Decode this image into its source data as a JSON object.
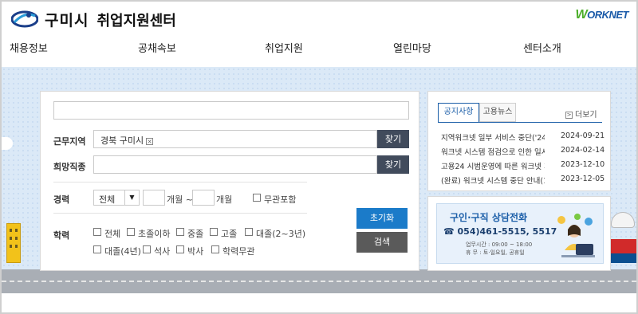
{
  "header": {
    "site_name": "구미시",
    "site_sub": "취업지원센터",
    "partner_logo_prefix": "W",
    "partner_logo": "ORKNET"
  },
  "nav": [
    "채용정보",
    "공채속보",
    "취업지원",
    "열린마당",
    "센터소개"
  ],
  "search": {
    "keyword_value": "",
    "region_label": "근무지역",
    "region_value": "경북 구미시",
    "region_remove_icon": "close-icon",
    "job_label": "희망직종",
    "job_value": "",
    "find_label": "찾기",
    "career_label": "경력",
    "career_select": "전체",
    "months_from_suffix": "개월 ~",
    "months_to_suffix": "개월",
    "career_any_label": "무관포함",
    "edu_label": "학력",
    "edu_options": [
      "전체",
      "초졸이하",
      "중졸",
      "고졸",
      "대졸(2~3년)",
      "대졸(4년)",
      "석사",
      "박사",
      "학력무관"
    ],
    "reset_label": "초기화",
    "search_label": "검색"
  },
  "notice": {
    "tab_active": "공지사항",
    "tab_inactive": "고용뉴스",
    "more_label": "더보기",
    "items": [
      {
        "title": "지역워크넷 일부 서비스 중단('24.9",
        "date": "2024-09-21"
      },
      {
        "title": "워크넷 시스템 점검으로 인한 일시",
        "date": "2024-02-14"
      },
      {
        "title": "고용24 시범운영에 따른 워크넷 개",
        "date": "2023-12-10"
      },
      {
        "title": "(완료) 워크넷 시스템 중단 안내(12",
        "date": "2023-12-05"
      }
    ]
  },
  "call_center": {
    "title": "구인·구직 상담전화",
    "phone": "☎ 054)461-5515, 5517",
    "hours_line1": "업무시간 : 09:00 ~ 18:00",
    "hours_line2": "휴    무 : 토·일요일, 공휴일"
  },
  "colors": {
    "accent_blue": "#1b7bc9",
    "dark_button": "#414b5c",
    "background": "#dbe9f7"
  }
}
